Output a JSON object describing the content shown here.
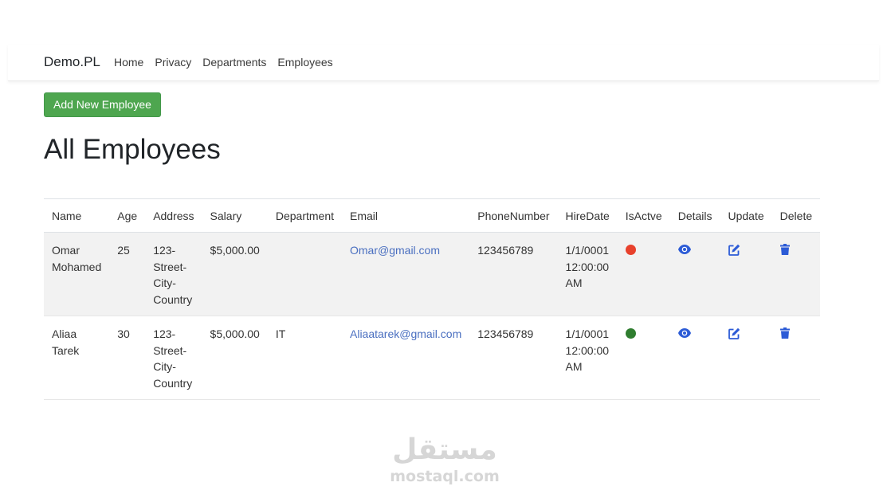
{
  "navbar": {
    "brand": "Demo.PL",
    "links": [
      "Home",
      "Privacy",
      "Departments",
      "Employees"
    ]
  },
  "actions": {
    "add_label": "Add New Employee"
  },
  "page": {
    "title": "All Employees"
  },
  "table": {
    "headers": [
      "Name",
      "Age",
      "Address",
      "Salary",
      "Department",
      "Email",
      "PhoneNumber",
      "HireDate",
      "IsActve",
      "Details",
      "Update",
      "Delete"
    ],
    "rows": [
      {
        "name_first": "Omar",
        "name_last": "Mohamed",
        "age": "25",
        "address": [
          "123-",
          "Street-",
          "City-",
          "Country"
        ],
        "salary": "$5,000.00",
        "department": "",
        "email": "Omar@gmail.com",
        "phone": "123456789",
        "hire_date": [
          "1/1/0001",
          "12:00:00",
          "AM"
        ],
        "is_active": false,
        "status_color": "#e8412c"
      },
      {
        "name_first": "Aliaa",
        "name_last": "Tarek",
        "age": "30",
        "address": [
          "123-",
          "Street-",
          "City-",
          "Country"
        ],
        "salary": "$5,000.00",
        "department": "IT",
        "email": "Aliaatarek@gmail.com",
        "phone": "123456789",
        "hire_date": [
          "1/1/0001",
          "12:00:00",
          "AM"
        ],
        "is_active": true,
        "status_color": "#2f7d2f"
      }
    ],
    "row_icons": [
      "eye-icon",
      "edit-icon",
      "trash-icon"
    ]
  },
  "colors": {
    "add_button": "#4ea64f",
    "link": "#4a6fc0",
    "icon": "#2c5bd6",
    "stripe": "#f2f2f2"
  },
  "watermark": {
    "logo": "مستقل",
    "text": "mostaql.com"
  }
}
